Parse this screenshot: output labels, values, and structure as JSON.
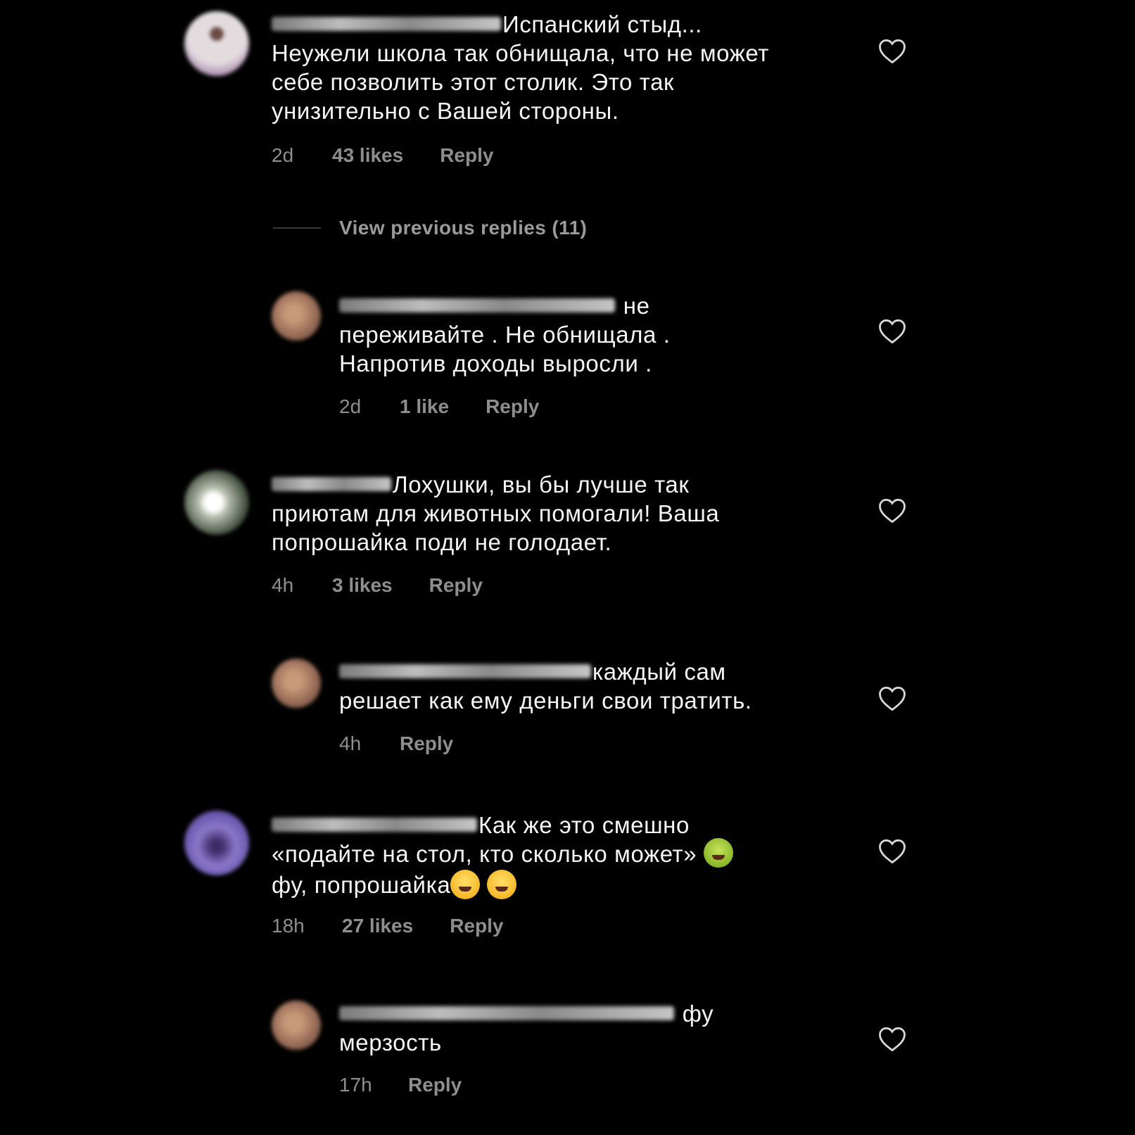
{
  "comments": [
    {
      "text_lines": [
        "Испанский стыд...",
        "Неужели школа так обнищала, что не может",
        "себе позволить этот столик. Это так",
        "унизительно с Вашей стороны."
      ],
      "time": "2d",
      "likes": "43 likes",
      "reply": "Reply"
    },
    {
      "text_lines": [
        "не",
        "переживайте . Не обнищала .",
        "Напротив доходы выросли ."
      ],
      "time": "2d",
      "likes": "1 like",
      "reply": "Reply"
    },
    {
      "text_lines": [
        "Лохушки, вы бы лучше так",
        "приютам для животных помогали! Ваша",
        "попрошайка поди не голодает."
      ],
      "time": "4h",
      "likes": "3 likes",
      "reply": "Reply"
    },
    {
      "text_lines": [
        "каждый сам",
        "решает как ему деньги свои тратить."
      ],
      "time": "4h",
      "reply": "Reply"
    },
    {
      "text_lines": [
        "Как же это смешно",
        "«подайте на стол, кто сколько может»",
        "фу, попрошайка"
      ],
      "time": "18h",
      "likes": "27 likes",
      "reply": "Reply"
    },
    {
      "text_lines": [
        "фу",
        "мерзость"
      ],
      "time": "17h",
      "reply": "Reply"
    }
  ],
  "view_previous_replies": "View previous replies (11)",
  "icons": {
    "like": "heart-outline-icon",
    "nauseated": "nauseated-face-emoji",
    "laughing": "tears-of-joy-emoji"
  }
}
